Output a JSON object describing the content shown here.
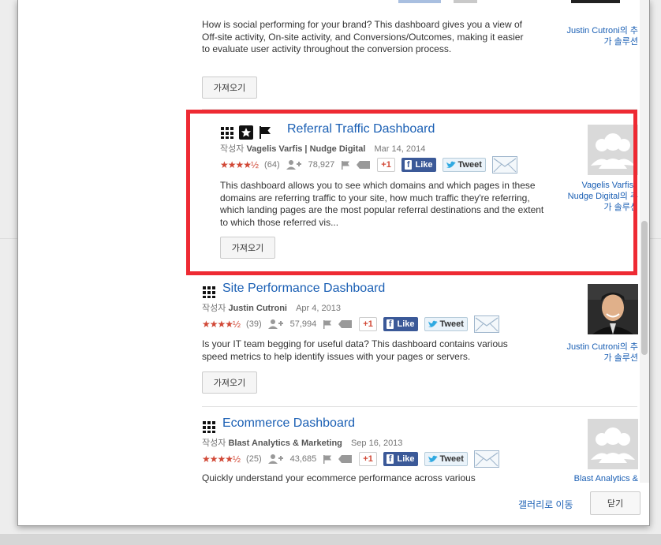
{
  "dashboards": [
    {
      "description": "How is social performing for your brand? This dashboard gives you a view of Off-site activity, On-site activity, and Conversions/Outcomes, making it easier to evaluate user activity throughout the conversion process.",
      "import_label": "가져오기",
      "author_link_line1": "Justin Cutroni의 추",
      "author_link_line2": "가 솔루션"
    },
    {
      "title": "Referral Traffic Dashboard",
      "author_prefix": "작성자",
      "author": "Vagelis Varfis | Nudge Digital",
      "date": "Mar 14, 2014",
      "rating_stars": "★★★★½",
      "ratings_count": "(64)",
      "users": "78,927",
      "gplus": "+1",
      "like": "Like",
      "tweet": "Tweet",
      "description": "This dashboard allows you to see which domains and which pages in these domains are referring traffic to your site, how much traffic they're referring, which landing pages are the most popular referral destinations and the extent to which those referred vis...",
      "import_label": "가져오기",
      "author_link_line1": "Vagelis Varfis |",
      "author_link_line2": "Nudge Digital의 추",
      "author_link_line3": "가 솔루션",
      "icons": [
        "grid-icon",
        "star-badge-icon",
        "flag-icon"
      ]
    },
    {
      "title": "Site Performance Dashboard",
      "author_prefix": "작성자",
      "author": "Justin Cutroni",
      "date": "Apr 4, 2013",
      "rating_stars": "★★★★½",
      "ratings_count": "(39)",
      "users": "57,994",
      "gplus": "+1",
      "like": "Like",
      "tweet": "Tweet",
      "description": "Is your IT team begging for useful data? This dashboard contains various speed metrics to help identify issues with your pages or servers.",
      "import_label": "가져오기",
      "author_link_line1": "Justin Cutroni의 추",
      "author_link_line2": "가 솔루션",
      "icons": [
        "grid-icon"
      ]
    },
    {
      "title": "Ecommerce Dashboard",
      "author_prefix": "작성자",
      "author": "Blast Analytics & Marketing",
      "date": "Sep 16, 2013",
      "rating_stars": "★★★★½",
      "ratings_count": "(25)",
      "users": "43,685",
      "gplus": "+1",
      "like": "Like",
      "tweet": "Tweet",
      "description": "Quickly understand your ecommerce performance across various",
      "author_link_line1": "Blast Analytics &",
      "icons": [
        "grid-icon"
      ]
    }
  ],
  "footer": {
    "gallery_link": "갤러리로 이동",
    "close_label": "닫기"
  },
  "colors": {
    "highlight": "#ee2a33",
    "link": "#1a5fb4",
    "stars": "#d14836",
    "facebook": "#3b5998"
  }
}
